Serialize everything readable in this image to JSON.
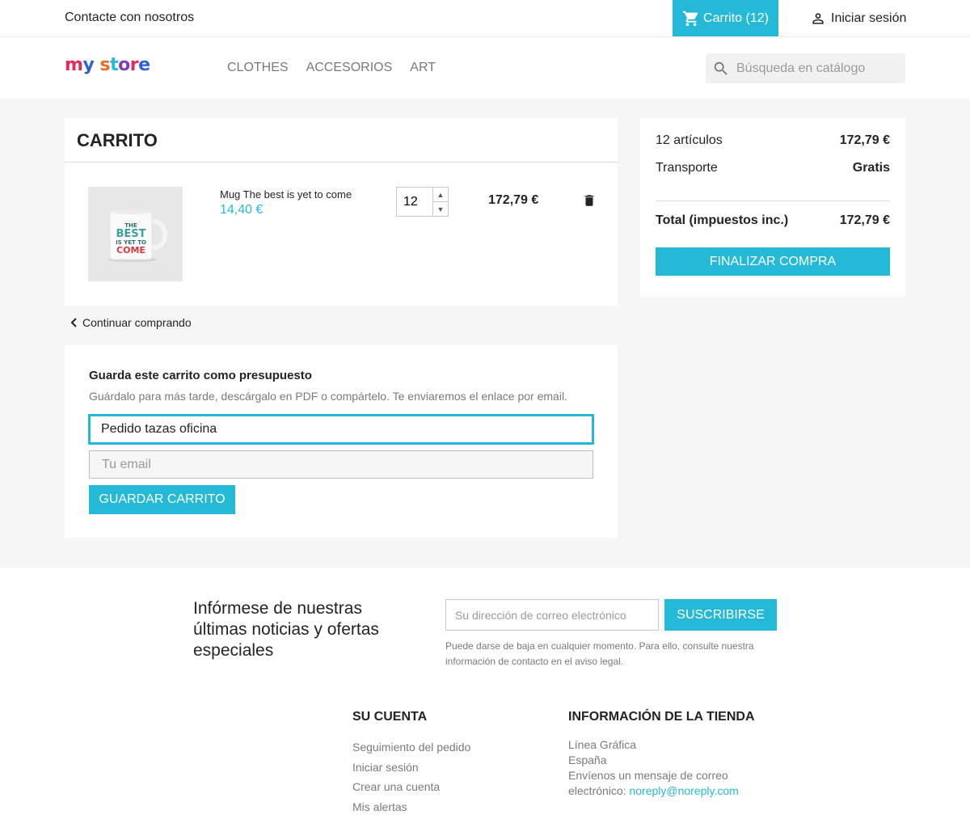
{
  "topbar": {
    "contact": "Contacte con nosotros",
    "cart": "Carrito (12)",
    "signin": "Iniciar sesión"
  },
  "header": {
    "logo": "my store",
    "nav": [
      "CLOTHES",
      "ACCESORIOS",
      "ART"
    ],
    "search_placeholder": "Búsqueda en catálogo"
  },
  "cart": {
    "title": "CARRITO",
    "item": {
      "name": "Mug The best is yet to come",
      "unit_price": "14,40 €",
      "quantity": "12",
      "line_total": "172,79 €",
      "image_text": [
        "THE",
        "BEST",
        "IS YET TO",
        "COME"
      ]
    },
    "continue": "Continuar comprando"
  },
  "save": {
    "title": "Guarda este carrito como presupuesto",
    "description": "Guárdalo para más tarde, descárgalo en PDF o compártelo. Te enviaremos el enlace por email.",
    "name_value": "Pedido tazas oficina",
    "email_placeholder": "Tu email",
    "button": "GUARDAR CARRITO"
  },
  "summary": {
    "items_label": "12 artículos",
    "items_value": "172,79 €",
    "shipping_label": "Transporte",
    "shipping_value": "Gratis",
    "total_label": "Total (impuestos inc.)",
    "total_value": "172,79 €",
    "checkout": "FINALIZAR COMPRA"
  },
  "newsletter": {
    "title": "Infórmese de nuestras últimas noticias y ofertas especiales",
    "placeholder": "Su dirección de correo electrónico",
    "button": "SUSCRIBIRSE",
    "note": "Puede darse de baja en cualquier momento. Para ello, consulte nuestra información de contacto en el aviso legal."
  },
  "footer": {
    "account_title": "SU CUENTA",
    "account_links": [
      "Seguimiento del pedido",
      "Iniciar sesión",
      "Crear una cuenta",
      "Mis alertas"
    ],
    "store_title": "INFORMACIÓN DE LA TIENDA",
    "store_lines": [
      "Línea Gráfica",
      "España"
    ],
    "store_mail_prefix": "Envíenos un mensaje de correo electrónico: ",
    "store_mail": "noreply@noreply.com"
  },
  "colors": {
    "accent": "#24b9d7",
    "background": "#f6f6f6"
  }
}
